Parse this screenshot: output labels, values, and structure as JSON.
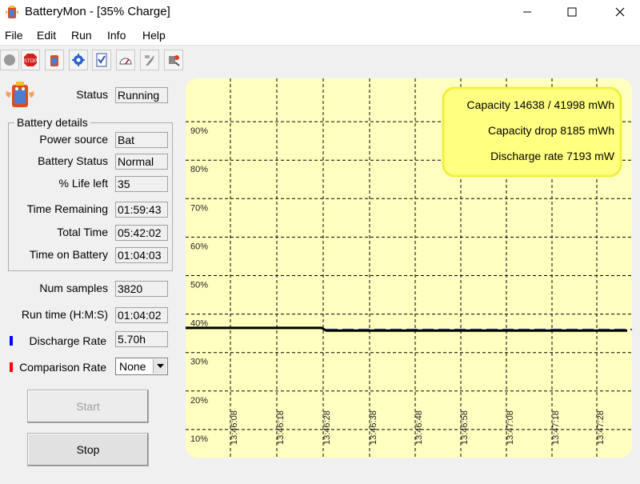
{
  "window": {
    "title": "BatteryMon - [35% Charge]"
  },
  "menu": [
    "File",
    "Edit",
    "Run",
    "Info",
    "Help"
  ],
  "toolbar": {
    "icons": [
      "record-icon",
      "stop-icon",
      "battery-icon",
      "settings-icon",
      "checklist-icon",
      "gauge-icon",
      "wrench-icon",
      "tools-icon"
    ]
  },
  "status": {
    "label": "Status",
    "value": "Running"
  },
  "battery_details": {
    "title": "Battery details",
    "fields": [
      {
        "label": "Power source",
        "value": "Bat"
      },
      {
        "label": "Battery Status",
        "value": "Normal"
      },
      {
        "label": "% Life left",
        "value": "35"
      },
      {
        "label": "Time Remaining",
        "value": "01:59:43"
      },
      {
        "label": "Total Time",
        "value": "05:42:02"
      },
      {
        "label": "Time on Battery",
        "value": "01:04:03"
      }
    ]
  },
  "stats": [
    {
      "label": "Num samples",
      "value": "3820"
    },
    {
      "label": "Run time (H:M:S)",
      "value": "01:04:02"
    },
    {
      "label": "Discharge Rate",
      "value": "5.70h"
    }
  ],
  "comparison": {
    "label": "Comparison Rate",
    "selected": "None"
  },
  "buttons": {
    "start": "Start",
    "stop": "Stop"
  },
  "colors": {
    "chart_bg": "#ffffc0",
    "info_box": "#ffff80",
    "discharge_marker": "#0000ff",
    "comparison_marker": "#ff0000",
    "charge_line": "#000000",
    "dashed_line": "#3a3aff"
  },
  "chart_data": {
    "type": "line",
    "y_ticks": [
      "90%",
      "80%",
      "70%",
      "60%",
      "50%",
      "40%",
      "30%",
      "20%",
      "10%"
    ],
    "y_range": [
      0,
      100
    ],
    "x_ticks": [
      "13:46:08",
      "13:46:18",
      "13:46:28",
      "13:46:38",
      "13:46:48",
      "13:46:58",
      "13:47:08",
      "13:47:18",
      "13:47:28"
    ],
    "grid": true,
    "series": [
      {
        "kind": "solid",
        "values": [
          36.4,
          36.4,
          36.4,
          35.7,
          35.7,
          35.7,
          35.7,
          35.7,
          35.7
        ]
      },
      {
        "kind": "dashed",
        "values": [
          null,
          null,
          null,
          36.0,
          36.0,
          36.0,
          36.0,
          36.0,
          36.0
        ]
      }
    ],
    "info": {
      "capacity": "Capacity 14638 / 41998 mWh",
      "capacity_drop": "Capacity drop 8185 mWh",
      "discharge_rate": "Discharge rate 7193 mW"
    }
  }
}
